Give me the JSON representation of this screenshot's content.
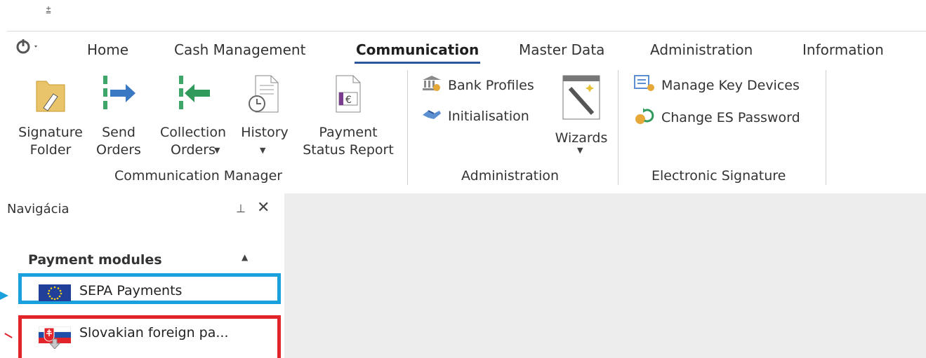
{
  "qat": {
    "glyph": "⩲"
  },
  "tabs": [
    {
      "label": "Home"
    },
    {
      "label": "Cash Management"
    },
    {
      "label": "Communication"
    },
    {
      "label": "Master Data"
    },
    {
      "label": "Administration"
    },
    {
      "label": "Information"
    }
  ],
  "ribbon": {
    "signature_folder": "Signature\nFolder",
    "send_orders": "Send\nOrders",
    "collection_orders": "Collection\nOrders",
    "history": "History",
    "payment_status_report": "Payment\nStatus Report",
    "bank_profiles": "Bank Profiles",
    "initialisation": "Initialisation",
    "wizards": "Wizards",
    "manage_key_devices": "Manage Key Devices",
    "change_es_password": "Change ES Password",
    "groups": {
      "communication_manager": "Communication Manager",
      "administration": "Administration",
      "electronic_signature": "Electronic Signature"
    }
  },
  "nav": {
    "title": "Navigácia",
    "pin_glyph": "⊥",
    "close_glyph": "✕",
    "section": "Payment modules",
    "collapse_glyph": "▲",
    "items": [
      {
        "label": "SEPA Payments"
      },
      {
        "label": "Slovakian foreign pa..."
      }
    ]
  },
  "colors": {
    "active_tab_underline": "#2b579a",
    "highlight_blue": "#1aa0dc",
    "highlight_red": "#e2242b",
    "content_bg": "#ededed"
  }
}
